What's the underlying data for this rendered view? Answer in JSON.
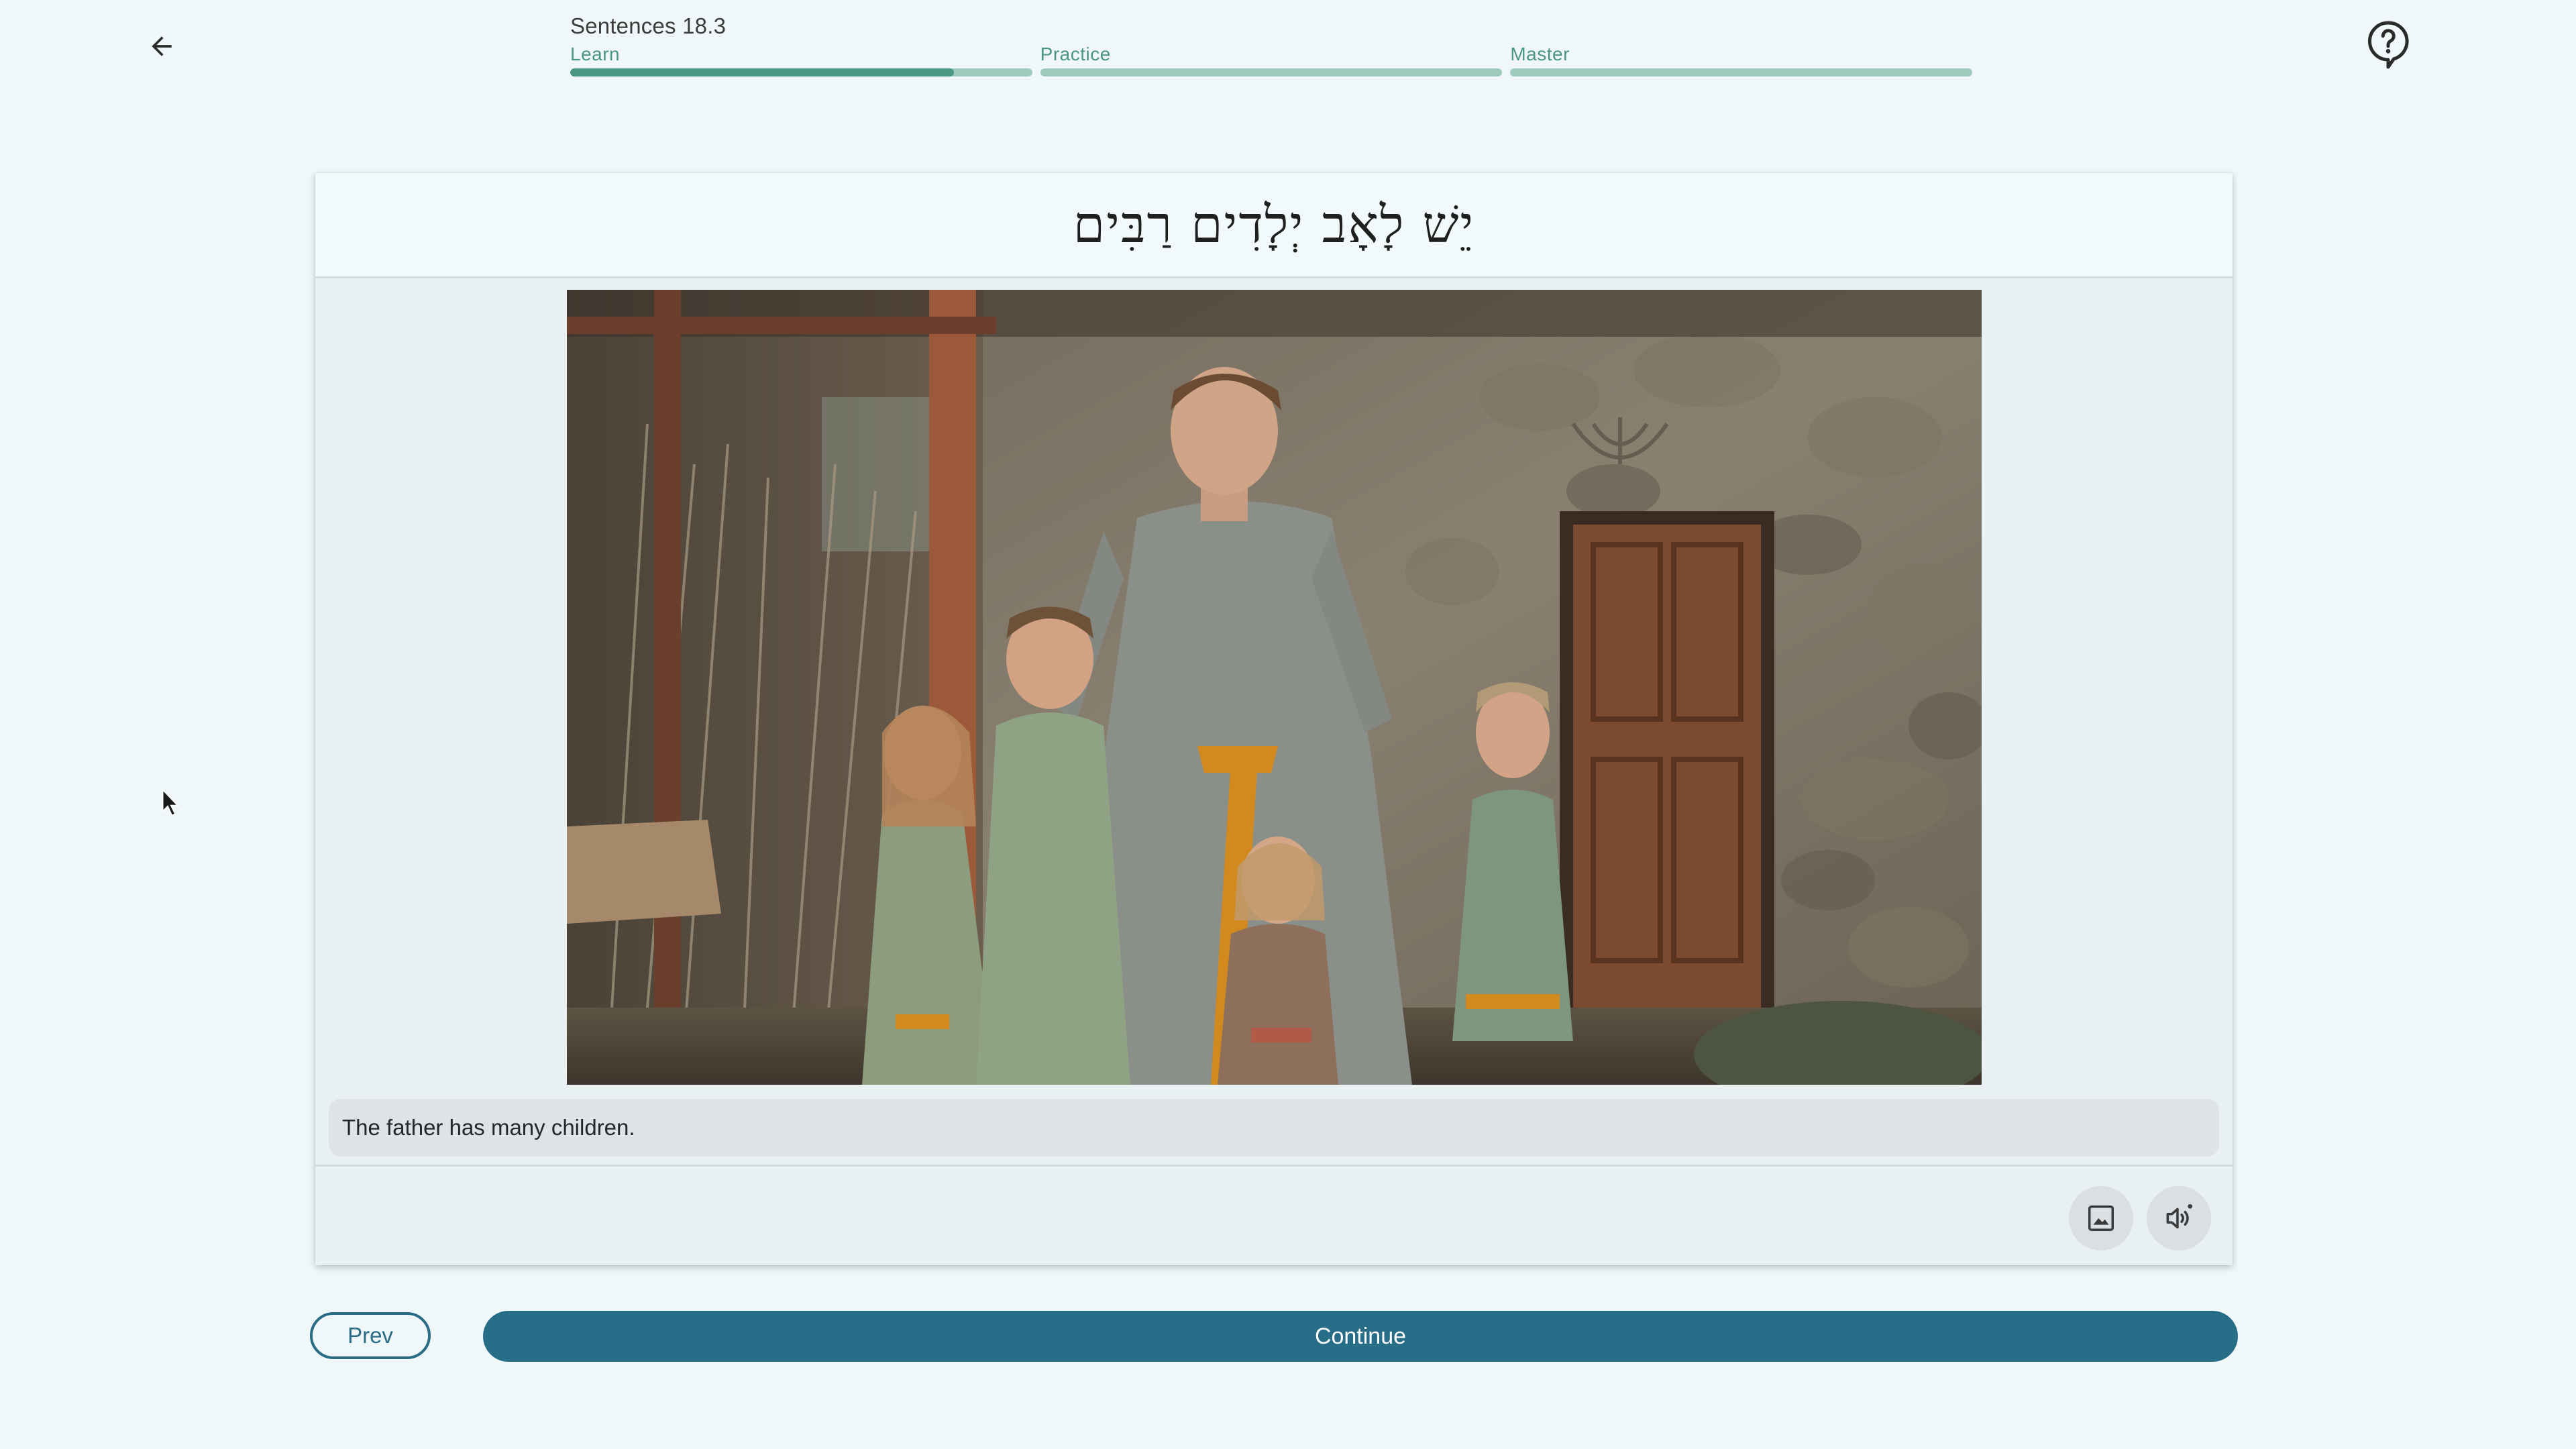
{
  "header": {
    "lesson_title": "Sentences 18.3",
    "back_icon": "arrow-left-icon",
    "help_icon": "question-mark-help-icon"
  },
  "progress": {
    "stages": [
      {
        "label": "Learn",
        "fill": 0.83
      },
      {
        "label": "Practice",
        "fill": 0
      },
      {
        "label": "Master",
        "fill": 0
      }
    ]
  },
  "card": {
    "hebrew_sentence": "יֵשׁ לָאָב יְלָדִים רַבִּים",
    "translation": "The father has many children.",
    "image_button_icon": "image-icon",
    "audio_button_icon": "speaker-audio-icon"
  },
  "nav": {
    "prev_label": "Prev",
    "continue_label": "Continue"
  },
  "colors": {
    "accent": "#286d88",
    "progress_fill": "#4b9583",
    "progress_track": "#9fcbbe",
    "background": "#eff7f9"
  }
}
